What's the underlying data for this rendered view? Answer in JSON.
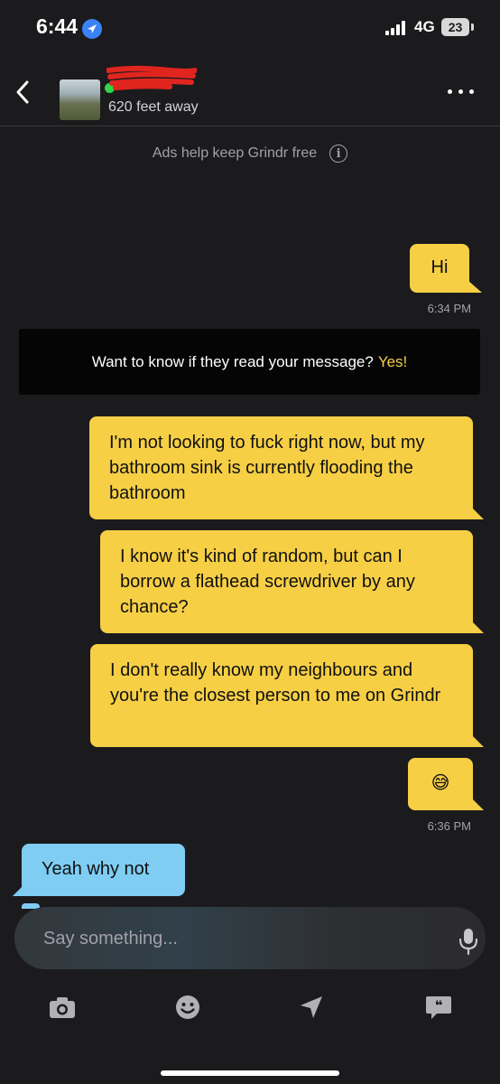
{
  "status_bar": {
    "time": "6:44",
    "network": "4G",
    "battery": "23"
  },
  "header": {
    "distance": "620 feet away",
    "back_icon": "chevron-left-icon",
    "more_icon": "more-horizontal-icon"
  },
  "ads_notice": {
    "text": "Ads help keep Grindr free",
    "icon": "info-icon",
    "icon_glyph": "i"
  },
  "messages": [
    {
      "direction": "outgoing",
      "text": "Hi"
    },
    {
      "timestamp": "6:34 PM"
    },
    {
      "direction": "outgoing",
      "text": "I'm not looking to fuck right now, but my bathroom sink is currently flooding the bathroom"
    },
    {
      "direction": "outgoing",
      "text": "I know it's kind of random, but can I borrow a flathead screwdriver by any chance?"
    },
    {
      "direction": "outgoing",
      "text": "I don't really know my neighbours and you're the closest person to me on Grindr"
    },
    {
      "direction": "outgoing",
      "text": "😅"
    },
    {
      "timestamp": "6:36 PM"
    },
    {
      "direction": "incoming",
      "text": "Yeah why not"
    }
  ],
  "read_receipt_banner": {
    "text": "Want to know if they read your message?",
    "action": "Yes!"
  },
  "composer": {
    "placeholder": "Say something...",
    "mic_icon": "microphone-icon"
  },
  "toolbar": {
    "items": [
      "camera-icon",
      "emoji-icon",
      "location-send-icon",
      "saved-phrases-icon"
    ]
  },
  "colors": {
    "background": "#1b1b1d",
    "outgoing_bubble": "#f6cf45",
    "incoming_bubble": "#7fcdf3",
    "accent_yes": "#f6cf45",
    "online": "#32d74b"
  }
}
